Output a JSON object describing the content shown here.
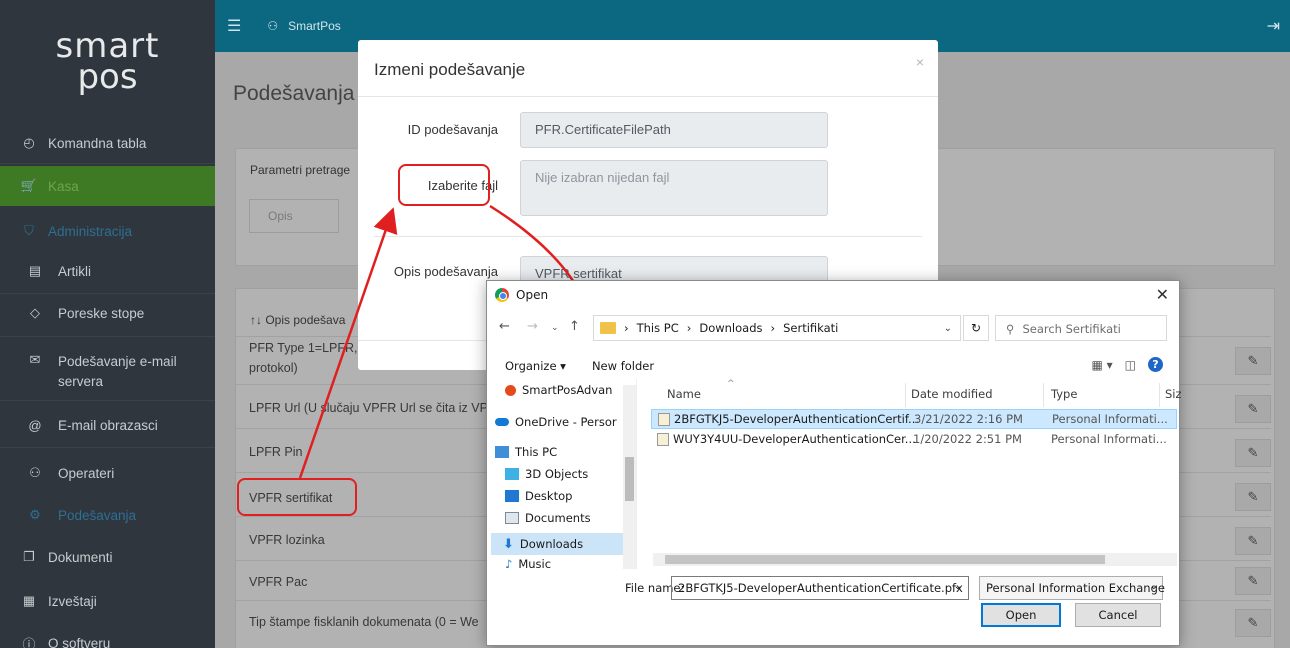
{
  "sidebar": {
    "logo_line1": "smart",
    "logo_line2": "pos",
    "items": [
      {
        "label": "Komandna tabla",
        "icon": "dashboard-icon"
      },
      {
        "label": "Kasa",
        "icon": "cart-icon"
      },
      {
        "label": "Administracija",
        "icon": "shield-icon"
      },
      {
        "label": "Artikli",
        "icon": "list-icon"
      },
      {
        "label": "Poreske stope",
        "icon": "tag-icon"
      },
      {
        "label": "Podešavanje e-mail servera",
        "icon": "envelope-icon"
      },
      {
        "label": "E-mail obrazasci",
        "icon": "at-icon"
      },
      {
        "label": "Operateri",
        "icon": "users-icon"
      },
      {
        "label": "Podešavanja",
        "icon": "gear-icon"
      },
      {
        "label": "Dokumenti",
        "icon": "documents-icon"
      },
      {
        "label": "Izveštaji",
        "icon": "reports-icon"
      },
      {
        "label": "O softveru",
        "icon": "info-icon"
      }
    ]
  },
  "topbar": {
    "user": "SmartPos"
  },
  "main": {
    "title": "Podešavanja",
    "search_title": "Parametri pretrage",
    "search_placeholder": "Opis",
    "table_header": "↑↓ Opis podešava",
    "rows": [
      "PFR Type 1=LPFR, 2",
      "protokol)",
      "LPFR Url (U slučaju VPFR Url se čita iz VPFR",
      "LPFR Pin",
      "VPFR sertifikat",
      "VPFR lozinka",
      "VPFR Pac",
      "Tip štampe fisklanih dokumenata (0 = We"
    ]
  },
  "modal": {
    "title": "Izmeni podešavanje",
    "close": "×",
    "id_label": "ID podešavanja",
    "id_value": "PFR.CertificateFilePath",
    "file_label": "Izaberite fajl",
    "file_placeholder": "Nije izabran nijedan fajl",
    "desc_label": "Opis podešavanja",
    "desc_value": "VPFR sertifikat"
  },
  "dialog": {
    "title": "Open",
    "close": "✕",
    "path": [
      "This PC",
      "Downloads",
      "Sertifikati"
    ],
    "search_placeholder": "Search Sertifikati",
    "organize": "Organize ▾",
    "new_folder": "New folder",
    "nav": [
      "SmartPosAdvan",
      "OneDrive - Persor",
      "This PC",
      "3D Objects",
      "Desktop",
      "Documents",
      "Downloads",
      "Music"
    ],
    "columns": {
      "name": "Name",
      "date": "Date modified",
      "type": "Type",
      "size": "Siz"
    },
    "files": [
      {
        "name": "2BFGTKJ5-DeveloperAuthenticationCertif...",
        "date": "3/21/2022 2:16 PM",
        "type": "Personal Informati..."
      },
      {
        "name": "WUY3Y4UU-DeveloperAuthenticationCer...",
        "date": "1/20/2022 2:51 PM",
        "type": "Personal Informati..."
      }
    ],
    "file_name_label": "File name:",
    "file_name_value": "2BFGTKJ5-DeveloperAuthenticationCertificate.pfx",
    "file_type": "Personal Information Exchange",
    "open_btn": "Open",
    "cancel_btn": "Cancel"
  },
  "colors": {
    "topbar": "#0c6781",
    "sidebar": "#2f363d",
    "active": "#3e7a24",
    "highlight": "#e02020"
  }
}
